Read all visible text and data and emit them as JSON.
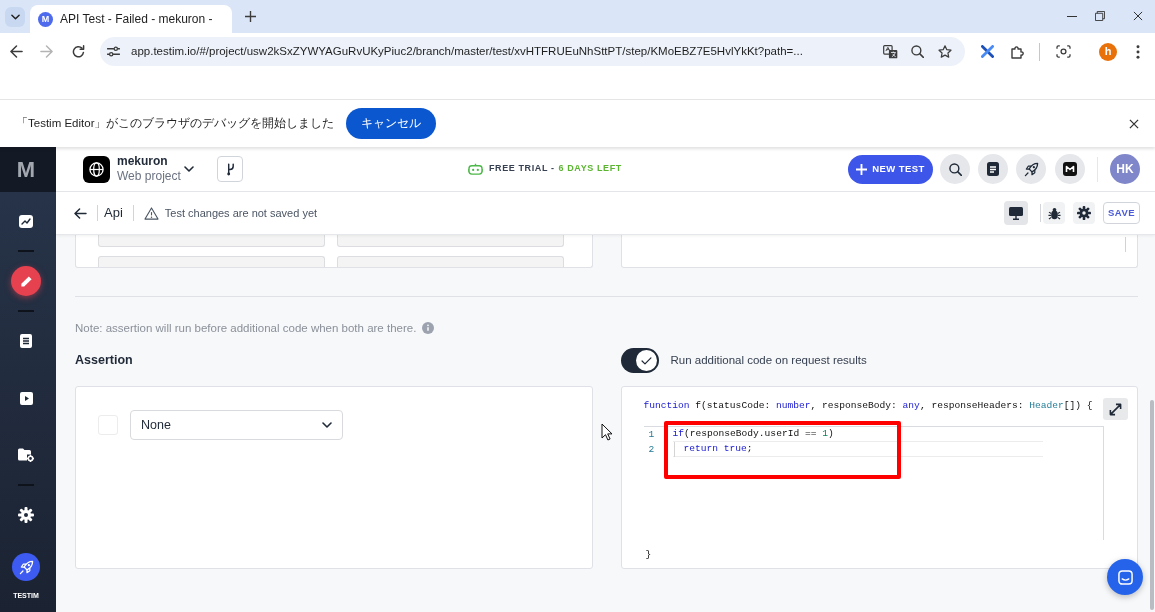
{
  "browser": {
    "tabs": [
      {
        "favicon": "M",
        "title": "API Test - Failed - mekuron -",
        "selected": true
      }
    ],
    "address_bar": {
      "url": "app.testim.io/#/project/usw2kSxZYWYAGuRvUKyPiuc2/branch/master/test/xvHTFRUEuNhSttPT/step/KMoEBZ7E5HvlYkKt?path=..."
    },
    "profile": {
      "initial": "h"
    }
  },
  "infobar": {
    "message": "「Testim Editor」がこのブラウザのデバッグを開始しました",
    "button": "キャンセル"
  },
  "sidebar": {
    "logo": "M",
    "groups": [
      {
        "items": [
          {
            "kind": "dashboard",
            "selected": false
          }
        ]
      },
      {
        "items": [
          {
            "kind": "editor",
            "selected": true
          }
        ]
      },
      {
        "items": [
          {
            "kind": "tests",
            "selected": false
          },
          {
            "kind": "runs",
            "selected": false
          },
          {
            "kind": "manage",
            "selected": false
          }
        ]
      },
      {
        "items": [
          {
            "kind": "settings",
            "selected": false
          }
        ]
      }
    ],
    "brand": {
      "label": "TESTIM"
    }
  },
  "header": {
    "project": {
      "name": "mekuron",
      "type": "Web project"
    },
    "trial": {
      "label": "FREE TRIAL -",
      "days": "6 DAYS LEFT"
    },
    "new_test_button": "NEW TEST",
    "avatar": "HK"
  },
  "toolbar": {
    "title": "Api",
    "warning": "Test changes are not saved yet",
    "save_button": "SAVE"
  },
  "content": {
    "note": "Note: assertion will run before additional code when both are there.",
    "assertion": {
      "label": "Assertion",
      "checked": false,
      "select": "None"
    },
    "code_toggle": {
      "label": "Run additional code on request results",
      "on": true
    },
    "editor": {
      "signature": [
        {
          "text": "function",
          "kind": "keyword"
        },
        {
          "text": " f(statusCode: ",
          "kind": "plain"
        },
        {
          "text": "number",
          "kind": "keyword"
        },
        {
          "text": ", responseBody: ",
          "kind": "plain"
        },
        {
          "text": "any",
          "kind": "keyword"
        },
        {
          "text": ", responseHeaders: ",
          "kind": "plain"
        },
        {
          "text": "Header",
          "kind": "type"
        },
        {
          "text": "[]) {",
          "kind": "plain"
        }
      ],
      "lines": [
        {
          "number": "1",
          "tokens": [
            {
              "text": "if",
              "kind": "keyword"
            },
            {
              "text": "(responseBody.userId == ",
              "kind": "plain"
            },
            {
              "text": "1",
              "kind": "number"
            },
            {
              "text": ")",
              "kind": "plain"
            }
          ],
          "children": [
            {
              "number": "2",
              "tokens": [
                {
                  "text": "return true",
                  "kind": "keyword"
                },
                {
                  "text": ";",
                  "kind": "plain"
                }
              ]
            }
          ]
        }
      ],
      "closing": "}",
      "highlighted": true
    }
  }
}
